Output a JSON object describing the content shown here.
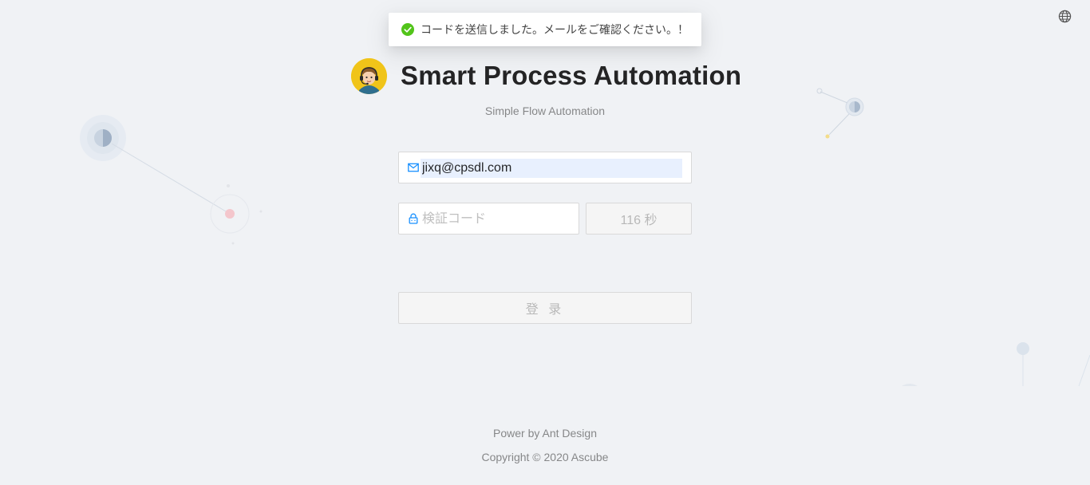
{
  "header": {
    "title": "Smart Process Automation",
    "subtitle": "Simple Flow Automation"
  },
  "toast": {
    "message": "コードを送信しました。メールをご確認ください。！",
    "status_color": "#52c41a"
  },
  "form": {
    "email_value": "jixq@cpsdl.com",
    "code_placeholder": "検証コード",
    "code_value": "",
    "countdown_label": "116 秒",
    "login_label": "登 录"
  },
  "footer": {
    "powered": "Power by Ant Design",
    "copyright": "Copyright © 2020 Ascube"
  },
  "icons": {
    "language": "globe-icon",
    "email": "mail-icon",
    "code": "lock-icon",
    "toast": "check-circle-icon"
  },
  "colors": {
    "background": "#f0f2f5",
    "icon_blue": "#1890ff",
    "autofill": "#e8f0fe"
  }
}
